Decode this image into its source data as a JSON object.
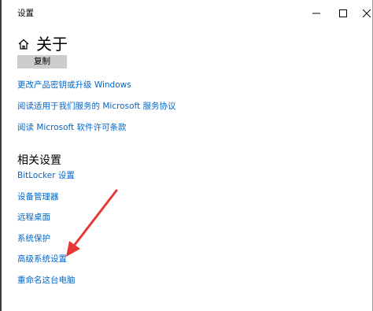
{
  "window": {
    "title": "设置"
  },
  "header": {
    "title": "关于"
  },
  "actions": {
    "copy_label": "复制"
  },
  "links": [
    "更改产品密钥或升级 Windows",
    "阅读适用于我们服务的 Microsoft 服务协议",
    "阅读 Microsoft 软件许可条款"
  ],
  "related": {
    "heading": "相关设置",
    "items": [
      "BitLocker 设置",
      "设备管理器",
      "远程桌面",
      "系统保护",
      "高级系统设置",
      "重命名这台电脑"
    ]
  },
  "colors": {
    "link": "#0066cc",
    "annotation_arrow": "#e53935"
  },
  "icons": {
    "home": "home-icon",
    "minimize": "minimize-icon",
    "maximize": "maximize-icon",
    "close": "close-icon"
  }
}
